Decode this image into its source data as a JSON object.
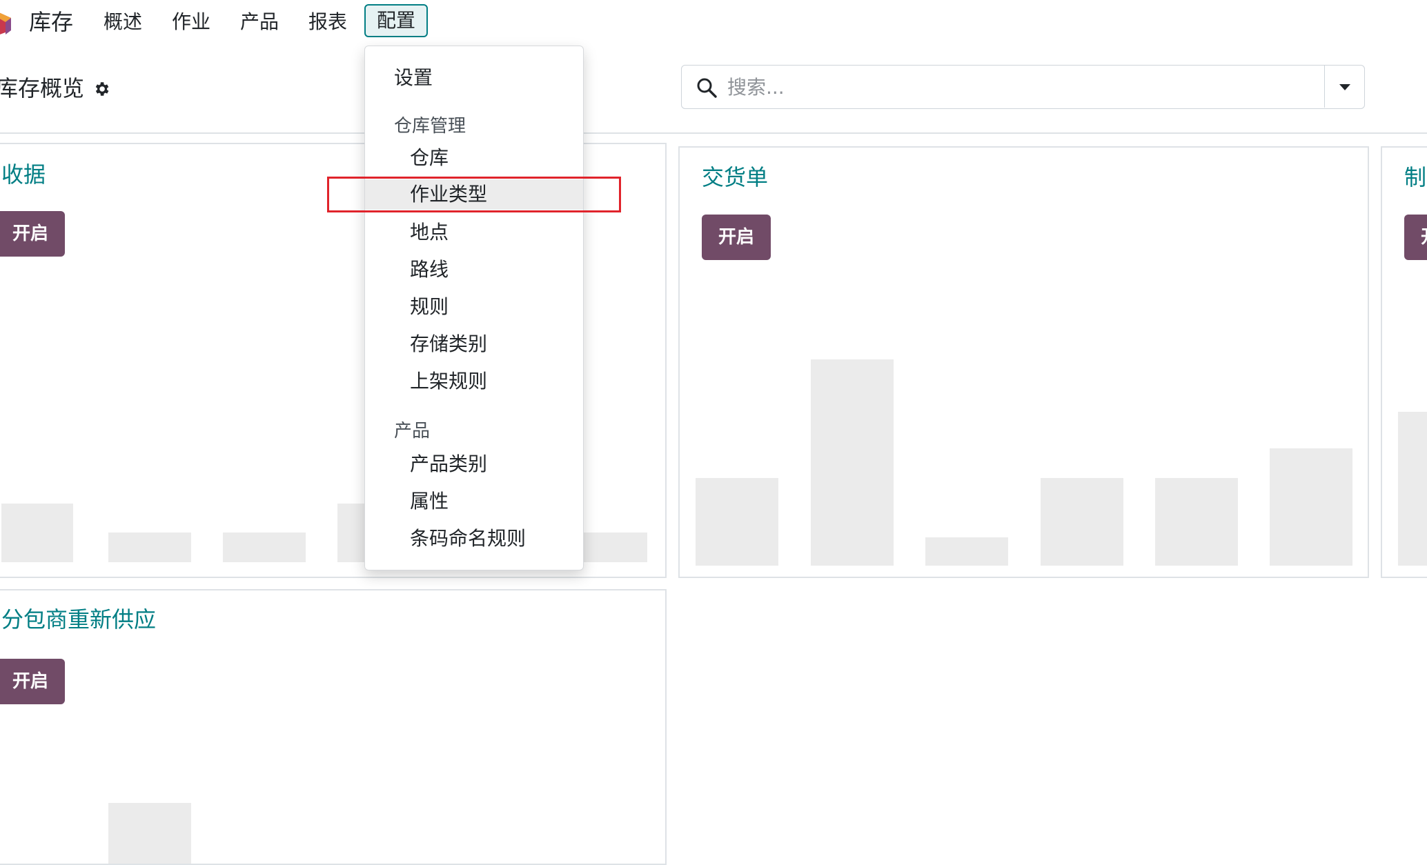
{
  "navbar": {
    "app_name": "库存",
    "menus": [
      {
        "label": "概述"
      },
      {
        "label": "作业"
      },
      {
        "label": "产品"
      },
      {
        "label": "报表"
      },
      {
        "label": "配置",
        "active": true
      }
    ]
  },
  "control_panel": {
    "page_title": "库存概览",
    "search_placeholder": "搜索..."
  },
  "dropdown": {
    "settings": "设置",
    "sections": [
      {
        "header": "仓库管理",
        "items": [
          "仓库",
          "作业类型",
          "地点",
          "路线",
          "规则",
          "存储类别",
          "上架规则"
        ]
      },
      {
        "header": "产品",
        "items": [
          "产品类别",
          "属性",
          "条码命名规则"
        ]
      }
    ],
    "hovered_item": "作业类型"
  },
  "cards": [
    {
      "title": "收据",
      "button": "开启"
    },
    {
      "title": "交货单",
      "button": "开启"
    },
    {
      "title": "制",
      "button": "开"
    },
    {
      "title": "分包商重新供应",
      "button": "开启"
    }
  ],
  "colors": {
    "brand": "#714b67",
    "accent": "#017e84",
    "highlight": "#e0232b",
    "placeholder_bar": "#ebebeb"
  }
}
